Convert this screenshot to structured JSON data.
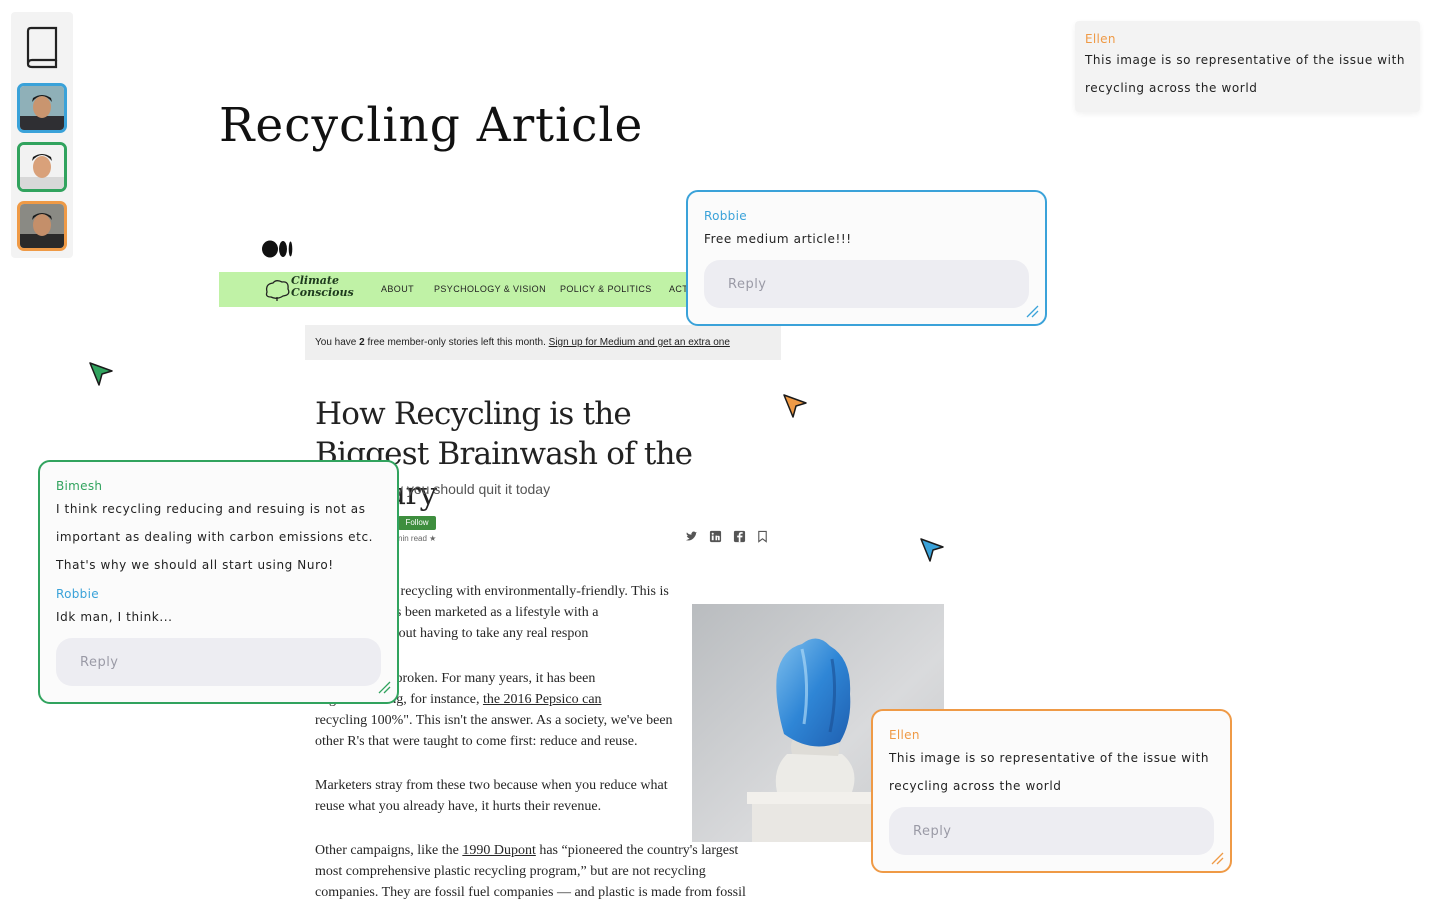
{
  "page": {
    "title": "Recycling Article"
  },
  "colors": {
    "blue": "#3aa2d9",
    "green": "#31a35e",
    "orange": "#ef9a46",
    "nav_green": "#c0f2a6"
  },
  "icons": {
    "toolbar": "book-icon",
    "medium": "medium-logo-icon",
    "cursor": "arrow-cursor-icon"
  },
  "toolbar": {
    "avatars": [
      {
        "name": "Robbie",
        "color": "#3aa2d9"
      },
      {
        "name": "Bimesh",
        "color": "#31a35e"
      },
      {
        "name": "Ellen",
        "color": "#ef9a46"
      }
    ]
  },
  "article": {
    "site_logo": "Climate\nConscious",
    "nav": [
      "ABOUT",
      "PSYCHOLOGY & VISION",
      "POLICY & POLITICS",
      "ACT"
    ],
    "banner_prefix": "You have ",
    "banner_count": "2",
    "banner_mid": " free member-only stories left this month. ",
    "banner_link": "Sign up for Medium and get an extra one",
    "title": "How Recycling is the Biggest Brainwash of the Century",
    "subtitle": "y you should quit it today",
    "follow": "Follow",
    "read_time": "nin read ★",
    "p1": [
      "orld associates recycling with environmentally-friendly. This is",
      "ling has always been marketed as a lifestyle with a",
      "of plastic, without having to take any real respon"
    ],
    "p2a": "ling system is broken. For many years, it has been",
    "p2b_start": "ough marketing, for instance, ",
    "p2b_link": "the 2016 Pepsico can",
    "p2c": "recycling 100%\". This isn't the answer. As a society, we've been",
    "p2d": "other R's that were taught to come first: reduce and reuse.",
    "p3a": "Marketers stray from these two because when you reduce what",
    "p3b": "reuse what you already have, it hurts their revenue.",
    "p4a_start": "Other campaigns, like the ",
    "p4a_link": "1990 Dupont",
    "p4a_end": " has “pioneered the country's largest",
    "p4b": "most comprehensive plastic recycling program,” but are not recycling",
    "p4c": "companies. They are fossil fuel companies — and plastic is made from fossil"
  },
  "comments": {
    "ellen_top": {
      "author": "Ellen",
      "lines": [
        "This image is so representative of the issue with",
        "recycling across the world"
      ]
    },
    "robbie": {
      "author": "Robbie",
      "text": "Free medium article!!!",
      "reply_placeholder": "Reply"
    },
    "bimesh": {
      "author": "Bimesh",
      "lines": [
        "I think recycling reducing and resuing is not as",
        "important as dealing with carbon emissions etc.",
        "That's why we should all start using Nuro!"
      ],
      "reply_author": "Robbie",
      "reply_text": "Idk man, I think...",
      "reply_placeholder": "Reply"
    },
    "ellen": {
      "author": "Ellen",
      "lines": [
        "This image is so representative of the issue with",
        "recycling across the world"
      ],
      "reply_placeholder": "Reply"
    }
  }
}
